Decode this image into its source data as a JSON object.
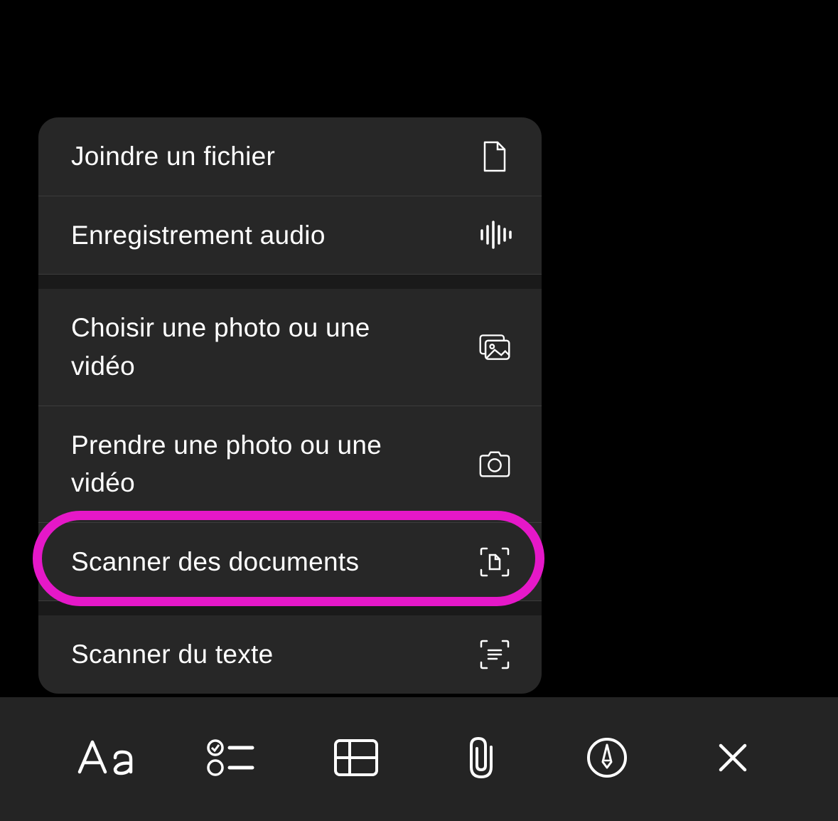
{
  "menu": {
    "items": [
      {
        "label": "Joindre un fichier",
        "icon": "file-icon"
      },
      {
        "label": "Enregistrement audio",
        "icon": "waveform-icon"
      },
      {
        "label": "Choisir une photo ou une vidéo",
        "icon": "photo-library-icon"
      },
      {
        "label": "Prendre une photo ou une vidéo",
        "icon": "camera-icon"
      },
      {
        "label": "Scanner des documents",
        "icon": "document-scanner-icon",
        "highlighted": true
      },
      {
        "label": "Scanner du texte",
        "icon": "text-scanner-icon"
      }
    ]
  },
  "toolbar": {
    "buttons": [
      {
        "name": "text-format-button",
        "icon": "text-format-icon"
      },
      {
        "name": "checklist-button",
        "icon": "checklist-icon"
      },
      {
        "name": "table-button",
        "icon": "table-icon"
      },
      {
        "name": "attachment-button",
        "icon": "paperclip-icon"
      },
      {
        "name": "markup-button",
        "icon": "markup-pen-icon"
      },
      {
        "name": "close-button",
        "icon": "close-icon"
      }
    ]
  },
  "colors": {
    "highlight": "#e518c8",
    "menu_bg": "#272727",
    "toolbar_bg": "#242424",
    "text": "#ffffff"
  }
}
